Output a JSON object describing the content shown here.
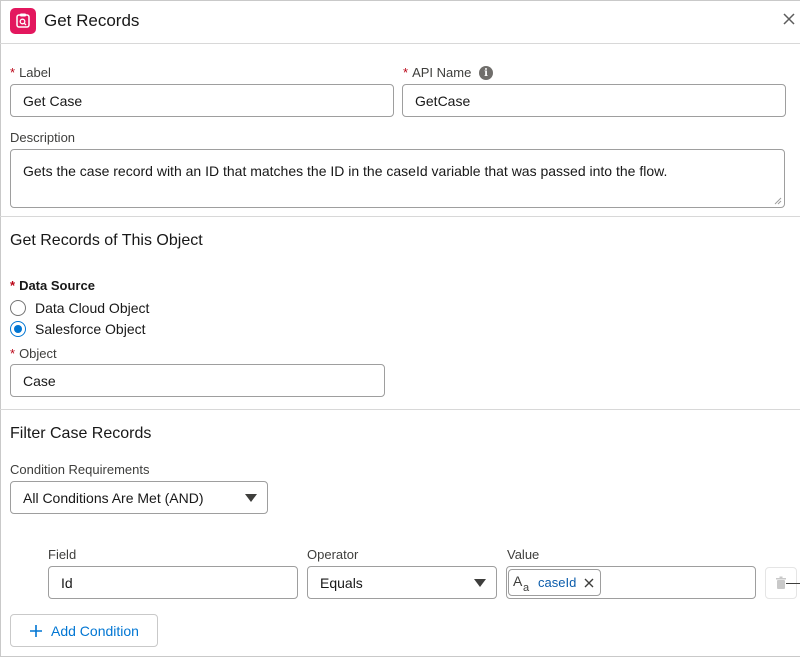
{
  "header": {
    "title": "Get Records",
    "icon": "get-records-icon"
  },
  "label_field": {
    "label": "Label",
    "value": "Get Case"
  },
  "api_name_field": {
    "label": "API Name",
    "value": "GetCase"
  },
  "description_field": {
    "label": "Description",
    "value": "Gets the case record with an ID that matches the ID in the caseId variable that was passed into the flow."
  },
  "object_section": {
    "title": "Get Records of This Object",
    "data_source_label": "Data Source",
    "options": [
      "Data Cloud Object",
      "Salesforce Object"
    ],
    "selected_option": "Salesforce Object",
    "object_label": "Object",
    "object_value": "Case"
  },
  "filter_section": {
    "title": "Filter Case Records",
    "condition_label": "Condition Requirements",
    "condition_value": "All Conditions Are Met (AND)",
    "columns": {
      "field": "Field",
      "operator": "Operator",
      "value": "Value"
    },
    "row": {
      "field": "Id",
      "operator": "Equals",
      "value_pill": "caseId"
    },
    "add_condition_label": "Add Condition"
  },
  "colors": {
    "accent": "#0176d3",
    "brand_icon": "#e3175e",
    "required": "#ba0517",
    "pill_text": "#0b5cab"
  }
}
